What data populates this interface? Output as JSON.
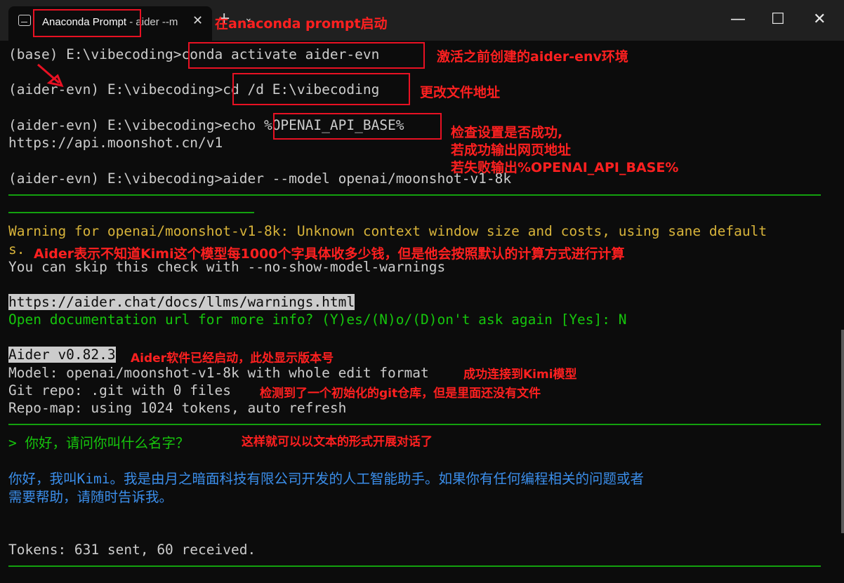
{
  "titlebar": {
    "tab_title": "Anaconda Prompt",
    "tab_subtitle": " - aider  --m",
    "close_tab": "✕",
    "new_tab": "+",
    "dropdown": "⌄",
    "minimize": "—",
    "maximize": "☐",
    "close_window": "✕"
  },
  "terminal": {
    "l1_prompt": "(base) E:\\vibecoding>",
    "l1_cmd": "conda activate aider-evn",
    "l2_prompt": "(aider-evn) E:\\vibecoding>",
    "l2_cmd": "cd /d E:\\vibecoding",
    "l3_prompt": "(aider-evn) E:\\vibecoding>echo ",
    "l3_cmd": "%OPENAI_API_BASE%",
    "l4": "https://api.moonshot.cn/v1",
    "l5": "(aider-evn) E:\\vibecoding>aider --model openai/moonshot-v1-8k",
    "warn1": "Warning for openai/moonshot-v1-8k: Unknown context window size and costs, using sane default",
    "warn2": "s.",
    "skip": "You can skip this check with --no-show-model-warnings",
    "url": "https://aider.chat/docs/llms/warnings.html",
    "open_doc": "Open documentation url for more info? (Y)es/(N)o/(D)on't ask again [Yes]: N",
    "version": "Aider v0.82.3",
    "model": "Model: openai/moonshot-v1-8k with whole edit format",
    "git": "Git repo: .git with 0 files",
    "repomap": "Repo-map: using 1024 tokens, auto refresh",
    "user_input": "> 你好，请问你叫什么名字？",
    "reply1": "你好，我叫Kimi。我是由月之暗面科技有限公司开发的人工智能助手。如果你有任何编程相关的问题或者",
    "reply2": "需要帮助，请随时告诉我。",
    "tokens": "Tokens: 631 sent, 60 received."
  },
  "annotations": {
    "a_start": "在anaconda prompt启动",
    "a_activate": "激活之前创建的aider-env环境",
    "a_cd": "更改文件地址",
    "a_check1": "检查设置是否成功,",
    "a_check2": "若成功输出网页地址",
    "a_check3": "若失败输出%OPENAI_API_BASE%",
    "a_cost": "Aider表示不知道Kimi这个模型每1000个字具体收多少钱，但是他会按照默认的计算方式进行计算",
    "a_version": "Aider软件已经启动，此处显示版本号",
    "a_model": "成功连接到Kimi模型",
    "a_git": "检测到了一个初始化的git仓库，但是里面还没有文件",
    "a_chat": "这样就可以以文本的形式开展对话了"
  },
  "colors": {
    "annotation": "#ff2020",
    "terminal_green": "#16c60c",
    "terminal_yellow": "#d7b33a",
    "terminal_blue": "#3b8eea"
  }
}
